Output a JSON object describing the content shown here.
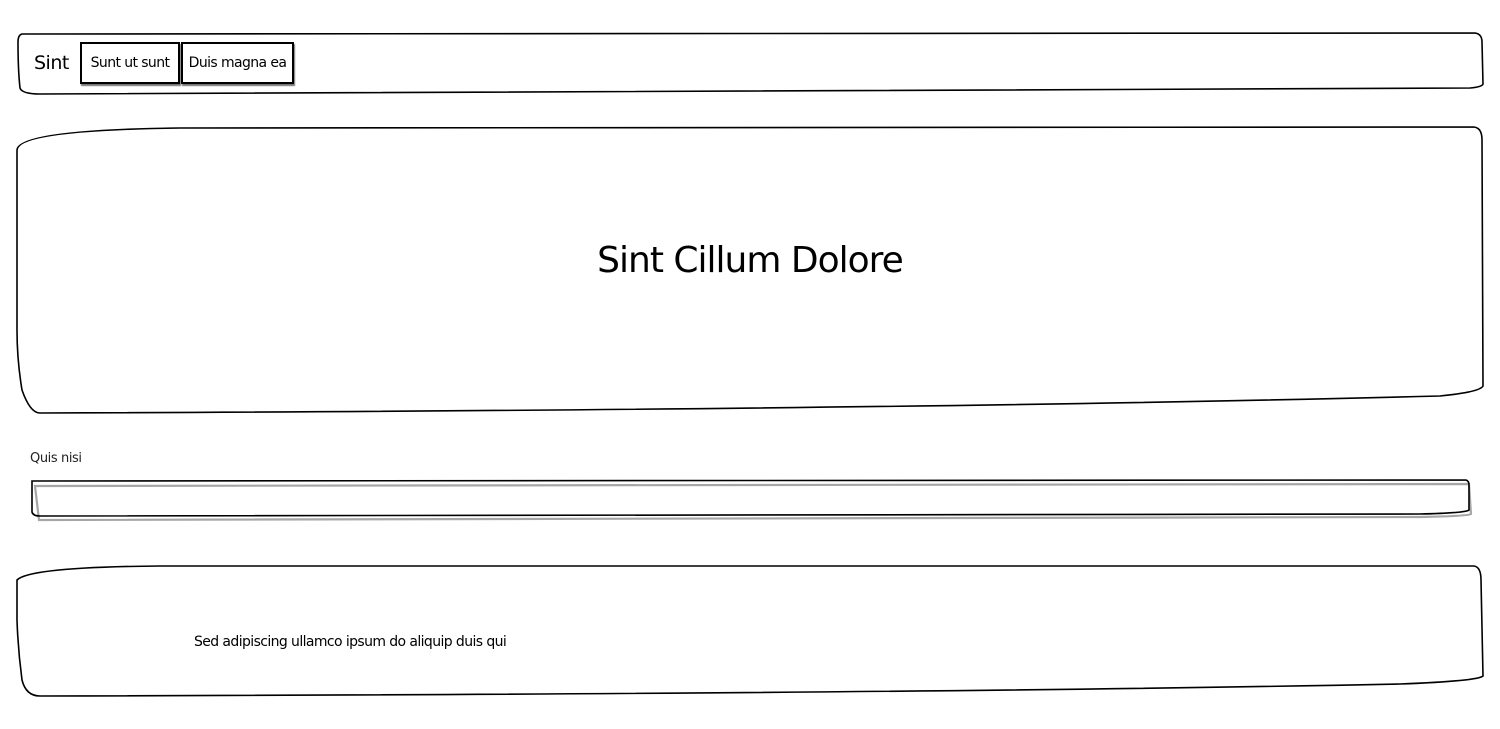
{
  "nav": {
    "brand": "Sint",
    "items": [
      {
        "label": "Sunt ut sunt"
      },
      {
        "label": "Duis magna ea"
      }
    ]
  },
  "hero": {
    "title": "Sint Cillum Dolore"
  },
  "form": {
    "field_label": "Quis nisi",
    "field_value": ""
  },
  "footer": {
    "text": "Sed adipiscing ullamco ipsum do aliquip duis qui"
  }
}
